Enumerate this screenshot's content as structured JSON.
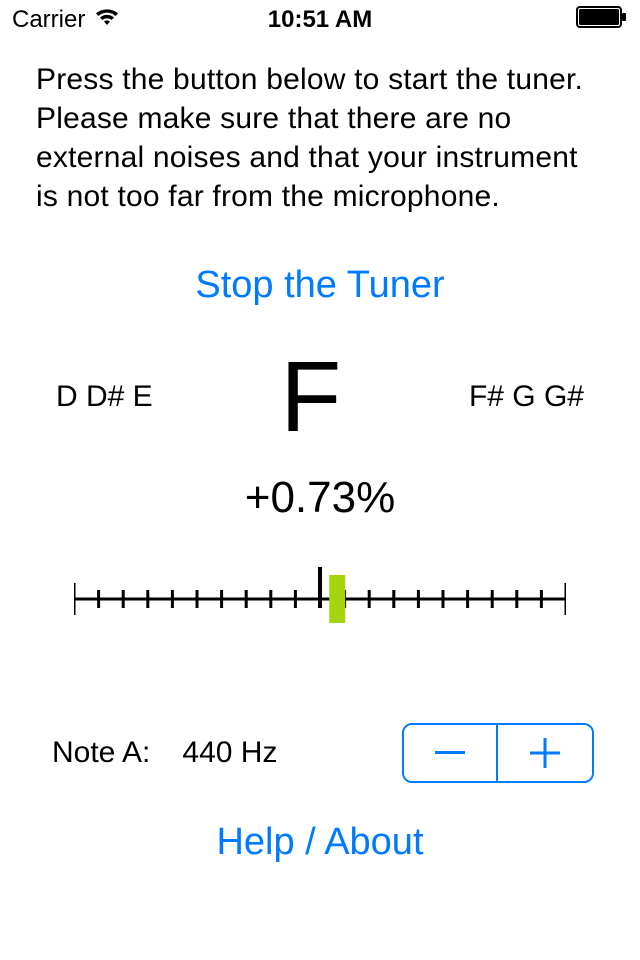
{
  "status": {
    "carrier": "Carrier",
    "time": "10:51 AM"
  },
  "instructions": "Press the button below to start the tuner. Please make sure that there are no external noises and that your instrument is not too far from the microphone.",
  "stop_button": "Stop the Tuner",
  "notes": {
    "left": "D D# E",
    "current": "F",
    "right": "F# G G#"
  },
  "offset_text": "+0.73%",
  "scale": {
    "indicator_percent": 53.5,
    "ticks_minor": 21,
    "ticks_major": [
      0,
      50,
      100
    ],
    "center_tick": 50
  },
  "reference": {
    "label": "Note A:",
    "value": "440 Hz"
  },
  "help_button": "Help / About"
}
